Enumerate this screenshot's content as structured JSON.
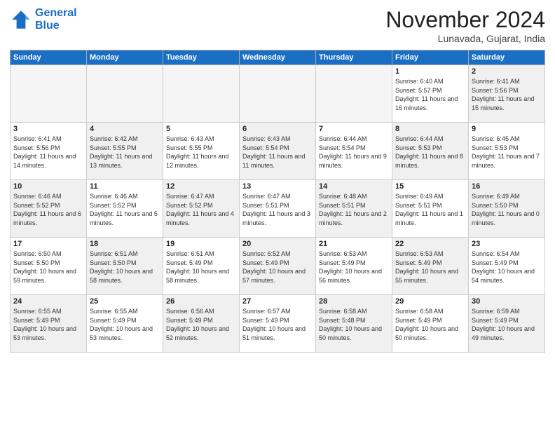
{
  "header": {
    "logo_line1": "General",
    "logo_line2": "Blue",
    "month": "November 2024",
    "location": "Lunavada, Gujarat, India"
  },
  "weekdays": [
    "Sunday",
    "Monday",
    "Tuesday",
    "Wednesday",
    "Thursday",
    "Friday",
    "Saturday"
  ],
  "weeks": [
    [
      {
        "day": "",
        "info": "",
        "shaded": true
      },
      {
        "day": "",
        "info": "",
        "shaded": true
      },
      {
        "day": "",
        "info": "",
        "shaded": true
      },
      {
        "day": "",
        "info": "",
        "shaded": true
      },
      {
        "day": "",
        "info": "",
        "shaded": true
      },
      {
        "day": "1",
        "info": "Sunrise: 6:40 AM\nSunset: 5:57 PM\nDaylight: 11 hours and 16 minutes."
      },
      {
        "day": "2",
        "info": "Sunrise: 6:41 AM\nSunset: 5:56 PM\nDaylight: 11 hours and 15 minutes.",
        "shaded": true
      }
    ],
    [
      {
        "day": "3",
        "info": "Sunrise: 6:41 AM\nSunset: 5:56 PM\nDaylight: 11 hours and 14 minutes."
      },
      {
        "day": "4",
        "info": "Sunrise: 6:42 AM\nSunset: 5:55 PM\nDaylight: 11 hours and 13 minutes.",
        "shaded": true
      },
      {
        "day": "5",
        "info": "Sunrise: 6:43 AM\nSunset: 5:55 PM\nDaylight: 11 hours and 12 minutes."
      },
      {
        "day": "6",
        "info": "Sunrise: 6:43 AM\nSunset: 5:54 PM\nDaylight: 11 hours and 11 minutes.",
        "shaded": true
      },
      {
        "day": "7",
        "info": "Sunrise: 6:44 AM\nSunset: 5:54 PM\nDaylight: 11 hours and 9 minutes."
      },
      {
        "day": "8",
        "info": "Sunrise: 6:44 AM\nSunset: 5:53 PM\nDaylight: 11 hours and 8 minutes.",
        "shaded": true
      },
      {
        "day": "9",
        "info": "Sunrise: 6:45 AM\nSunset: 5:53 PM\nDaylight: 11 hours and 7 minutes."
      }
    ],
    [
      {
        "day": "10",
        "info": "Sunrise: 6:46 AM\nSunset: 5:52 PM\nDaylight: 11 hours and 6 minutes.",
        "shaded": true
      },
      {
        "day": "11",
        "info": "Sunrise: 6:46 AM\nSunset: 5:52 PM\nDaylight: 11 hours and 5 minutes."
      },
      {
        "day": "12",
        "info": "Sunrise: 6:47 AM\nSunset: 5:52 PM\nDaylight: 11 hours and 4 minutes.",
        "shaded": true
      },
      {
        "day": "13",
        "info": "Sunrise: 6:47 AM\nSunset: 5:51 PM\nDaylight: 11 hours and 3 minutes."
      },
      {
        "day": "14",
        "info": "Sunrise: 6:48 AM\nSunset: 5:51 PM\nDaylight: 11 hours and 2 minutes.",
        "shaded": true
      },
      {
        "day": "15",
        "info": "Sunrise: 6:49 AM\nSunset: 5:51 PM\nDaylight: 11 hours and 1 minute."
      },
      {
        "day": "16",
        "info": "Sunrise: 6:49 AM\nSunset: 5:50 PM\nDaylight: 11 hours and 0 minutes.",
        "shaded": true
      }
    ],
    [
      {
        "day": "17",
        "info": "Sunrise: 6:50 AM\nSunset: 5:50 PM\nDaylight: 10 hours and 59 minutes."
      },
      {
        "day": "18",
        "info": "Sunrise: 6:51 AM\nSunset: 5:50 PM\nDaylight: 10 hours and 58 minutes.",
        "shaded": true
      },
      {
        "day": "19",
        "info": "Sunrise: 6:51 AM\nSunset: 5:49 PM\nDaylight: 10 hours and 58 minutes."
      },
      {
        "day": "20",
        "info": "Sunrise: 6:52 AM\nSunset: 5:49 PM\nDaylight: 10 hours and 57 minutes.",
        "shaded": true
      },
      {
        "day": "21",
        "info": "Sunrise: 6:53 AM\nSunset: 5:49 PM\nDaylight: 10 hours and 56 minutes."
      },
      {
        "day": "22",
        "info": "Sunrise: 6:53 AM\nSunset: 5:49 PM\nDaylight: 10 hours and 55 minutes.",
        "shaded": true
      },
      {
        "day": "23",
        "info": "Sunrise: 6:54 AM\nSunset: 5:49 PM\nDaylight: 10 hours and 54 minutes."
      }
    ],
    [
      {
        "day": "24",
        "info": "Sunrise: 6:55 AM\nSunset: 5:49 PM\nDaylight: 10 hours and 53 minutes.",
        "shaded": true
      },
      {
        "day": "25",
        "info": "Sunrise: 6:55 AM\nSunset: 5:49 PM\nDaylight: 10 hours and 53 minutes."
      },
      {
        "day": "26",
        "info": "Sunrise: 6:56 AM\nSunset: 5:49 PM\nDaylight: 10 hours and 52 minutes.",
        "shaded": true
      },
      {
        "day": "27",
        "info": "Sunrise: 6:57 AM\nSunset: 5:49 PM\nDaylight: 10 hours and 51 minutes."
      },
      {
        "day": "28",
        "info": "Sunrise: 6:58 AM\nSunset: 5:48 PM\nDaylight: 10 hours and 50 minutes.",
        "shaded": true
      },
      {
        "day": "29",
        "info": "Sunrise: 6:58 AM\nSunset: 5:49 PM\nDaylight: 10 hours and 50 minutes."
      },
      {
        "day": "30",
        "info": "Sunrise: 6:59 AM\nSunset: 5:49 PM\nDaylight: 10 hours and 49 minutes.",
        "shaded": true
      }
    ]
  ]
}
